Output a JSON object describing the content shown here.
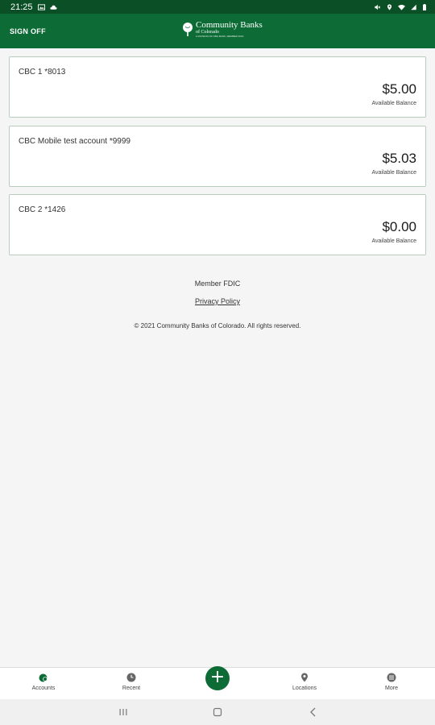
{
  "status_bar": {
    "time": "21:25",
    "left_icons": [
      "image-icon",
      "cloud-icon"
    ],
    "right_icons": [
      "mute-icon",
      "location-icon",
      "wifi-icon",
      "signal-icon",
      "battery-icon"
    ]
  },
  "header": {
    "sign_off_label": "SIGN OFF",
    "logo": {
      "name": "Community Banks",
      "sub": "of Colorado",
      "tagline": "A DIVISION OF NBH BANK, MEMBER FDIC"
    },
    "colors": {
      "header_bg": "#0d6b35",
      "status_bg": "#0b4f26"
    }
  },
  "accounts": [
    {
      "name": "CBC 1 *8013",
      "amount": "$5.00",
      "balance_label": "Available Balance"
    },
    {
      "name": "CBC Mobile test account *9999",
      "amount": "$5.03",
      "balance_label": "Available Balance"
    },
    {
      "name": "CBC 2 *1426",
      "amount": "$0.00",
      "balance_label": "Available Balance"
    }
  ],
  "footer": {
    "fdic": "Member FDIC",
    "privacy_link": "Privacy Policy",
    "copyright": "© 2021 Community Banks of Colorado. All rights reserved."
  },
  "bottom_nav": {
    "items": [
      {
        "label": "Accounts",
        "icon": "accounts-icon",
        "active": true
      },
      {
        "label": "Recent",
        "icon": "recent-icon",
        "active": false
      },
      {
        "label": "Locations",
        "icon": "location-pin-icon",
        "active": false
      },
      {
        "label": "More",
        "icon": "more-icon",
        "active": false
      }
    ],
    "fab_icon": "plus-icon",
    "active_color": "#0d6b35",
    "inactive_color": "#666666"
  },
  "system_nav": {
    "icons": [
      "recents-icon",
      "home-icon",
      "back-icon"
    ]
  }
}
